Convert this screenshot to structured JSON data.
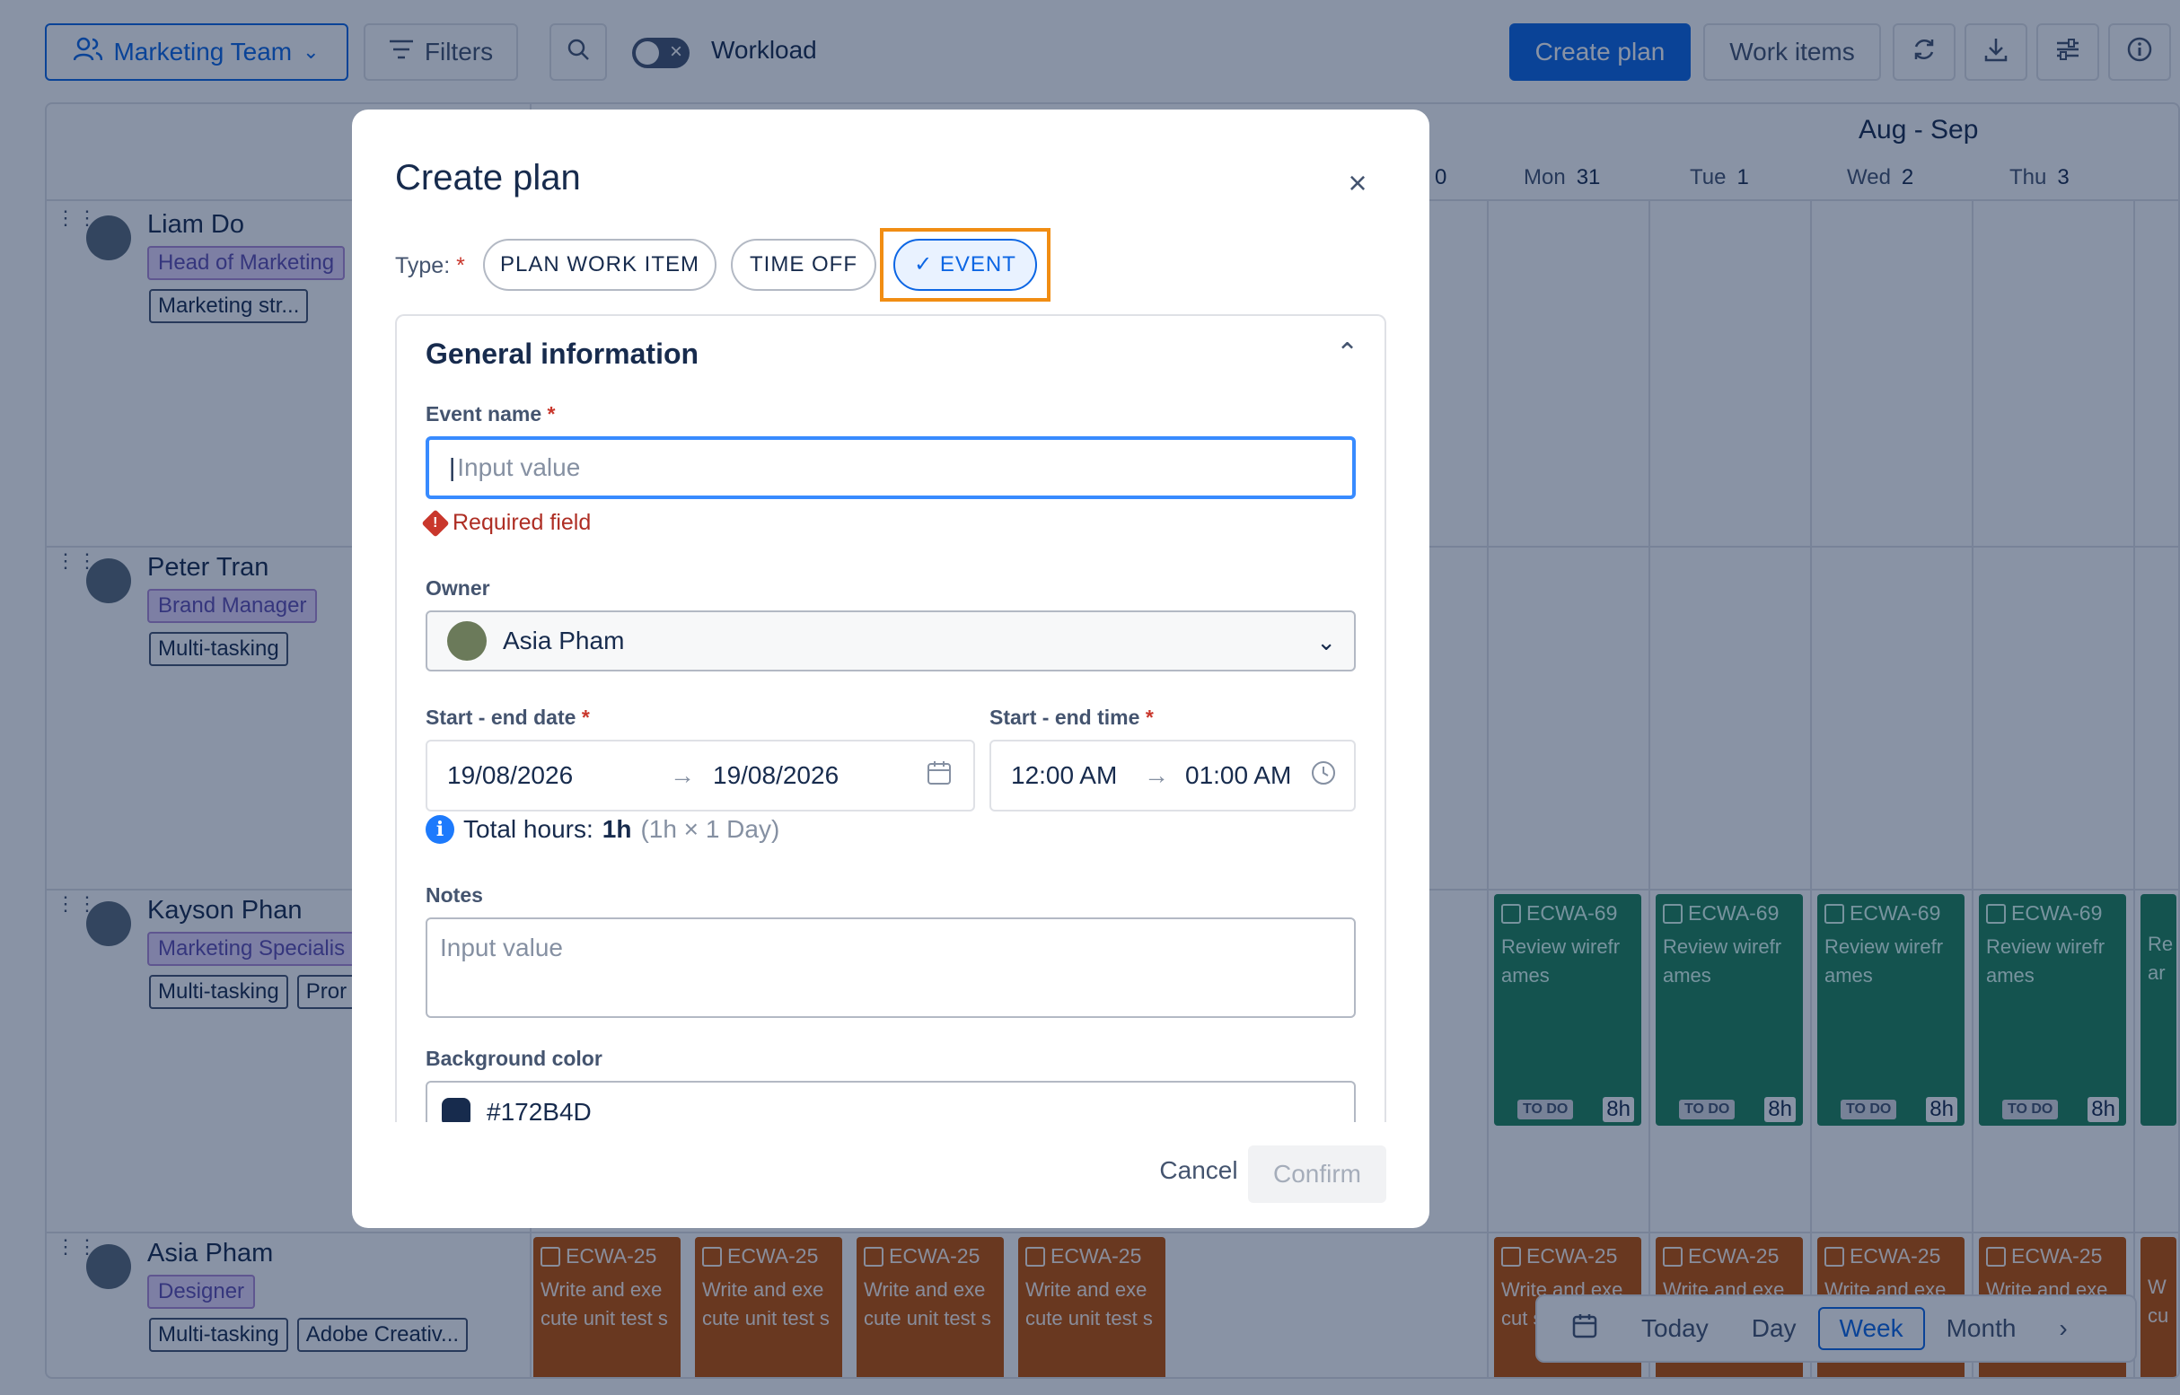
{
  "toolbar": {
    "team_label": "Marketing Team",
    "filters_label": "Filters",
    "workload_label": "Workload",
    "create_plan_label": "Create plan",
    "work_items_label": "Work items"
  },
  "calendar": {
    "month_label": "Aug - Sep",
    "days": [
      {
        "name": "Mon",
        "num": "31"
      },
      {
        "name": "Tue",
        "num": "1"
      },
      {
        "name": "Wed",
        "num": "2"
      },
      {
        "name": "Thu",
        "num": "3"
      }
    ],
    "partial_day_num": "0",
    "people": [
      {
        "name": "Liam Do",
        "role": "Head of Marketing",
        "skills": [
          "Marketing str..."
        ]
      },
      {
        "name": "Peter Tran",
        "role": "Brand Manager",
        "skills": [
          "Multi-tasking"
        ]
      },
      {
        "name": "Kayson Phan",
        "role": "Marketing Specialis",
        "skills": [
          "Multi-tasking",
          "Pror"
        ]
      },
      {
        "name": "Asia Pham",
        "role": "Designer",
        "skills": [
          "Multi-tasking",
          "Adobe Creativ..."
        ]
      }
    ],
    "green_task": {
      "id": "ECWA-69",
      "title": "Review wirefr ames",
      "status": "TO DO",
      "hours": "8h",
      "partial_title": "Re ar"
    },
    "orange_task": {
      "id": "ECWA-25",
      "title": "Write and exe cute unit test s",
      "title_short": "Write and exe cut s",
      "partial_title": "W cu"
    },
    "view_switch": {
      "today": "Today",
      "day": "Day",
      "week": "Week",
      "month": "Month"
    }
  },
  "modal": {
    "title": "Create plan",
    "type_label": "Type:",
    "required_mark": "*",
    "types": {
      "plan": "PLAN WORK ITEM",
      "time_off": "TIME OFF",
      "event": "EVENT"
    },
    "check_mark": "✓",
    "section_title": "General information",
    "event_name_label": "Event name",
    "event_name_placeholder": "Input value",
    "required_error": "Required field",
    "owner_label": "Owner",
    "owner_value": "Asia Pham",
    "date_label": "Start - end date",
    "start_date": "19/08/2026",
    "end_date": "19/08/2026",
    "time_label": "Start - end time",
    "start_time": "12:00 AM",
    "end_time": "01:00 AM",
    "total_prefix": "Total hours:",
    "total_value": "1h",
    "total_detail": "(1h × 1 Day)",
    "notes_label": "Notes",
    "notes_placeholder": "Input value",
    "bg_color_label": "Background color",
    "bg_color_value": "#172B4D",
    "cancel_label": "Cancel",
    "confirm_label": "Confirm"
  },
  "colors": {
    "accent": "#0C66E4",
    "green_task": "#1F845A",
    "orange_task": "#C25100",
    "highlight": "#F18D13",
    "error": "#C9372C"
  }
}
